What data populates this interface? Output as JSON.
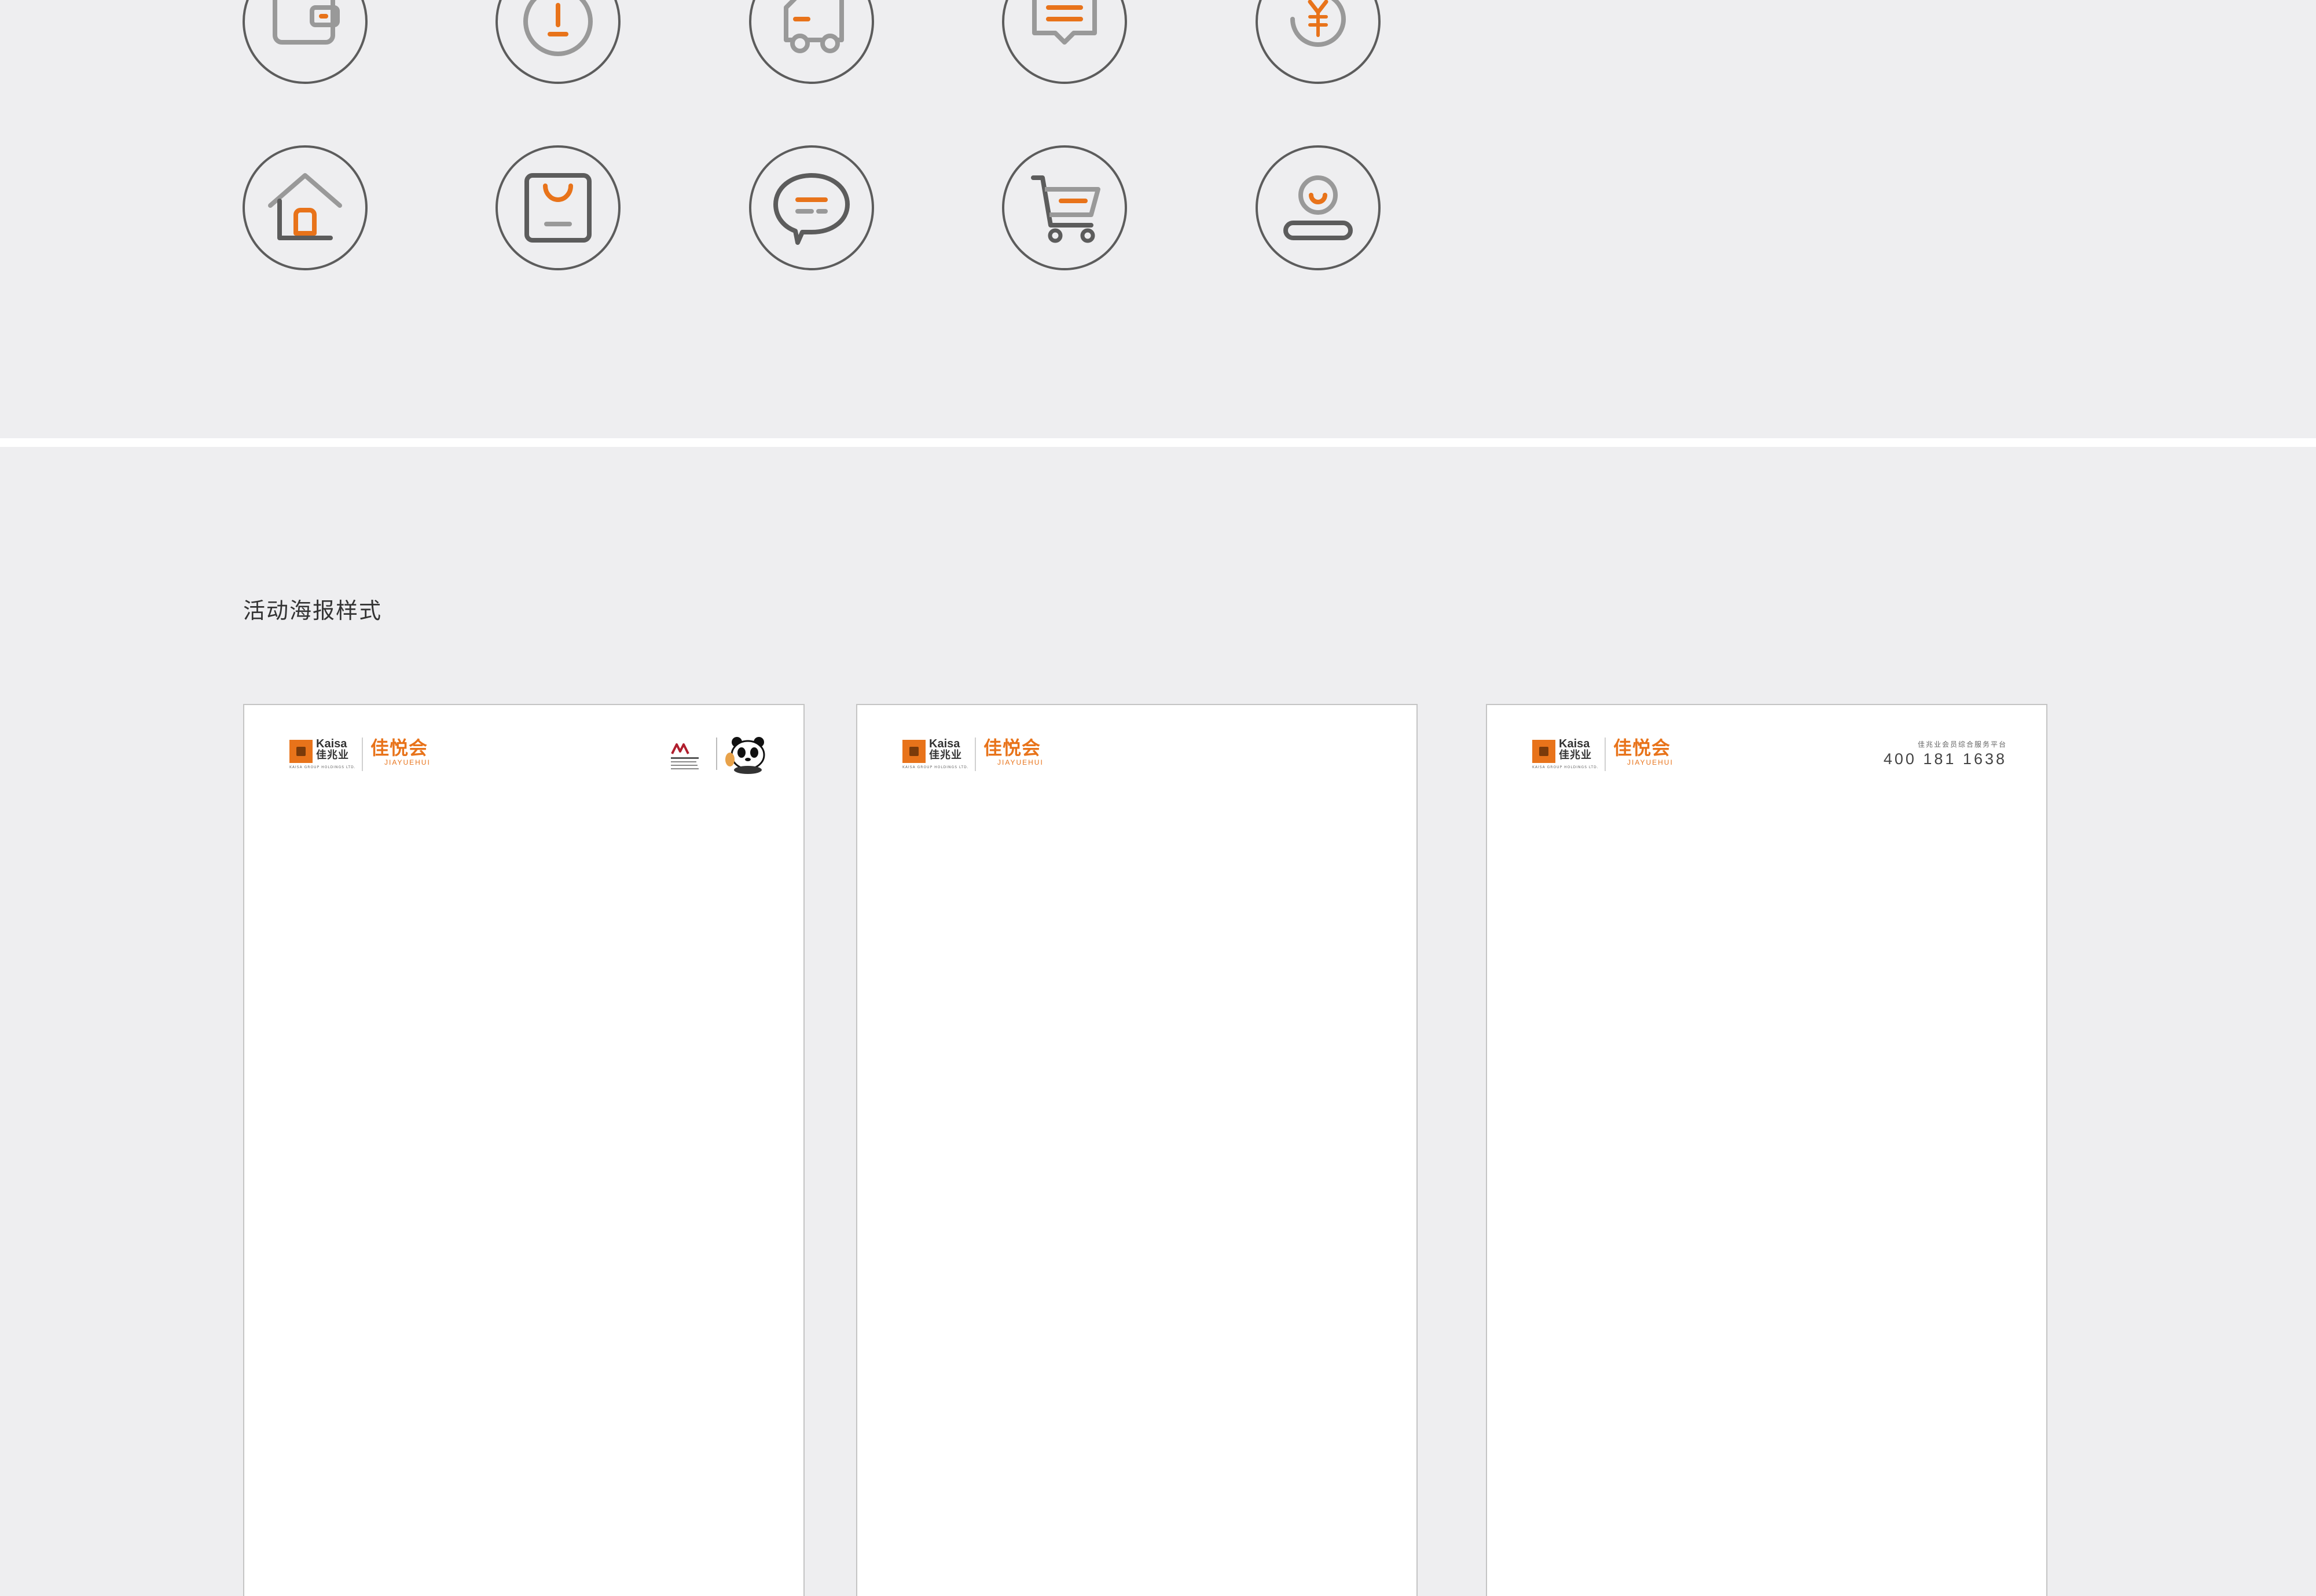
{
  "section_title": "活动海报样式",
  "colors": {
    "accent": "#e8731a",
    "icon_stroke": "#5c5c5c",
    "icon_light": "#999999",
    "panel": "#eeeef0"
  },
  "icon_rows": [
    [
      "wallet-icon",
      "clock-icon",
      "delivery-truck-icon",
      "message-icon",
      "yuan-coin-icon"
    ],
    [
      "home-icon",
      "shopping-bag-icon",
      "chat-bubble-icon",
      "shopping-cart-icon",
      "user-profile-icon"
    ]
  ],
  "posters": [
    {
      "brand_en": "Kaisa",
      "brand_cn": "佳兆业",
      "brand_sub": "KAISA GROUP HOLDINGS LTD.",
      "club_cn": "佳悦会",
      "club_en": "JIAYUEHUI",
      "partner": "marriott-logo-and-panda-mascot"
    },
    {
      "brand_en": "Kaisa",
      "brand_cn": "佳兆业",
      "brand_sub": "KAISA GROUP HOLDINGS LTD.",
      "club_cn": "佳悦会",
      "club_en": "JIAYUEHUI"
    },
    {
      "brand_en": "Kaisa",
      "brand_cn": "佳兆业",
      "brand_sub": "KAISA GROUP HOLDINGS LTD.",
      "club_cn": "佳悦会",
      "club_en": "JIAYUEHUI",
      "hotline_label": "佳兆业会员综合服务平台",
      "hotline_number": "400 181 1638"
    }
  ]
}
